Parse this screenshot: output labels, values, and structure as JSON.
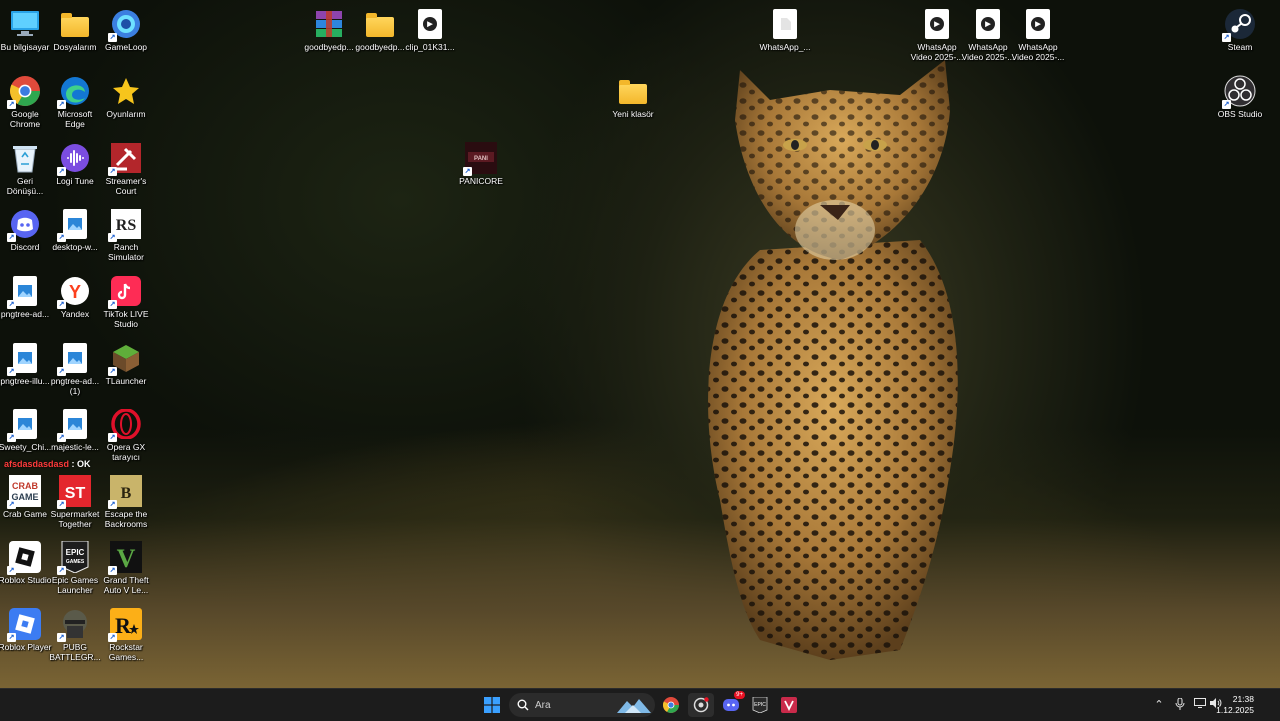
{
  "desktop": {
    "icons": [
      {
        "id": "bu-bilgisayar",
        "label": "Bu bilgisayar",
        "icon": "monitor-icon"
      },
      {
        "id": "dosyalarim",
        "label": "Dosyalarım",
        "icon": "folder-icon"
      },
      {
        "id": "gameloop",
        "label": "GameLoop",
        "icon": "gameloop-icon"
      },
      {
        "id": "chrome",
        "label": "Google Chrome",
        "icon": "chrome-icon"
      },
      {
        "id": "edge",
        "label": "Microsoft Edge",
        "icon": "edge-icon"
      },
      {
        "id": "oyunlarim",
        "label": "Oyunlarım",
        "icon": "star-icon"
      },
      {
        "id": "geri-donusum",
        "label": "Geri Dönüşü...",
        "icon": "recycle-bin-icon"
      },
      {
        "id": "logi-tune",
        "label": "Logi Tune",
        "icon": "logi-tune-icon"
      },
      {
        "id": "streamers-court",
        "label": "Streamer's Court",
        "icon": "streamers-court-icon"
      },
      {
        "id": "discord",
        "label": "Discord",
        "icon": "discord-icon"
      },
      {
        "id": "desktop-w",
        "label": "desktop-w...",
        "icon": "image-file-icon"
      },
      {
        "id": "ranch-simulator",
        "label": "Ranch Simulator",
        "icon": "ranch-simulator-icon"
      },
      {
        "id": "pngtree-ad",
        "label": "pngtree-ad...",
        "icon": "image-file-icon"
      },
      {
        "id": "yandex",
        "label": "Yandex",
        "icon": "yandex-icon"
      },
      {
        "id": "tiktok-live",
        "label": "TikTok LIVE Studio",
        "icon": "tiktok-icon"
      },
      {
        "id": "pngtree-illu",
        "label": "pngtree-illu...",
        "icon": "image-file-icon"
      },
      {
        "id": "pngtree-ad-1",
        "label": "pngtree-ad... (1)",
        "icon": "image-file-icon"
      },
      {
        "id": "tlauncher",
        "label": "TLauncher",
        "icon": "tlauncher-icon"
      },
      {
        "id": "sweety-chi",
        "label": "Sweety_Chi...",
        "icon": "image-file-icon"
      },
      {
        "id": "majestic-le",
        "label": "majestic-le...",
        "icon": "image-file-icon"
      },
      {
        "id": "opera-gx",
        "label": "Opera GX tarayıcı",
        "icon": "opera-gx-icon"
      },
      {
        "id": "crab-game",
        "label": "Crab Game",
        "icon": "crab-game-icon"
      },
      {
        "id": "supermarket",
        "label": "Supermarket Together",
        "icon": "supermarket-icon"
      },
      {
        "id": "escape-backrooms",
        "label": "Escape the Backrooms",
        "icon": "backrooms-icon"
      },
      {
        "id": "roblox-studio",
        "label": "Roblox Studio",
        "icon": "roblox-studio-icon"
      },
      {
        "id": "epic-games",
        "label": "Epic Games Launcher",
        "icon": "epic-games-icon"
      },
      {
        "id": "gta-v",
        "label": "Grand Theft Auto V Le...",
        "icon": "gta-icon"
      },
      {
        "id": "roblox-player",
        "label": "Roblox Player",
        "icon": "roblox-player-icon"
      },
      {
        "id": "pubg",
        "label": "PUBG BATTLEGR...",
        "icon": "pubg-icon"
      },
      {
        "id": "rockstar",
        "label": "Rockstar Games...",
        "icon": "rockstar-icon"
      },
      {
        "id": "goodbyedp-1",
        "label": "goodbyedp...",
        "icon": "winrar-icon"
      },
      {
        "id": "goodbyedp-2",
        "label": "goodbyedp...",
        "icon": "folder-icon"
      },
      {
        "id": "clip",
        "label": "clip_01K31...",
        "icon": "video-file-icon"
      },
      {
        "id": "whatsapp-file",
        "label": "WhatsApp_...",
        "icon": "blank-file-icon"
      },
      {
        "id": "wa-video-1",
        "label": "WhatsApp Video 2025-...",
        "icon": "video-file-icon"
      },
      {
        "id": "wa-video-2",
        "label": "WhatsApp Video 2025-...",
        "icon": "video-file-icon"
      },
      {
        "id": "wa-video-3",
        "label": "WhatsApp Video 2025-...",
        "icon": "video-file-icon"
      },
      {
        "id": "steam",
        "label": "Steam",
        "icon": "steam-icon"
      },
      {
        "id": "obs",
        "label": "OBS Studio",
        "icon": "obs-icon"
      },
      {
        "id": "yeni-klasor",
        "label": "Yeni klasör",
        "icon": "folder-icon"
      },
      {
        "id": "panicore",
        "label": "PANICORE",
        "icon": "panicore-icon"
      }
    ],
    "overlay_text": {
      "name": "afsdasdasdasd",
      "suffix": ": OK"
    }
  },
  "taskbar": {
    "search_placeholder": "Ara",
    "clock_time": "21:38",
    "clock_date": "1.12.2025",
    "discord_badge": "9+"
  },
  "colors": {
    "taskbar_bg": "#1c1c1c",
    "accent": "#0078d4"
  }
}
